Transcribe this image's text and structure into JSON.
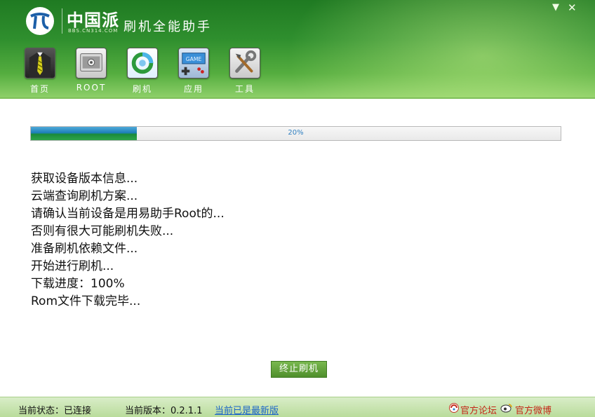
{
  "app": {
    "logo_text": "中国派",
    "logo_sub": "BBS.CN314.COM",
    "title": "刷机全能助手"
  },
  "window": {
    "minimize": "▼",
    "close": "✕"
  },
  "nav": [
    {
      "label": "首页",
      "icon": "tie-icon"
    },
    {
      "label": "ROOT",
      "icon": "root-icon"
    },
    {
      "label": "刷机",
      "icon": "flash-refresh-icon"
    },
    {
      "label": "应用",
      "icon": "game-icon"
    },
    {
      "label": "工具",
      "icon": "tools-icon"
    }
  ],
  "progress": {
    "value": 0.2,
    "text": "20%"
  },
  "log": [
    "获取设备版本信息...",
    "云端查询刷机方案...",
    "请确认当前设备是用易助手Root的...",
    "否则有很大可能刷机失败...",
    "准备刷机依赖文件...",
    "开始进行刷机...",
    "下载进度：100%",
    "Rom文件下载完毕..."
  ],
  "actions": {
    "stop_label": "终止刷机"
  },
  "status": {
    "state": "当前状态：已连接",
    "version": "当前版本：0.2.1.1",
    "latest": "当前已是最新版",
    "forum": "官方论坛",
    "weibo": "官方微博"
  },
  "colors": {
    "header_green": "#2f8f2e",
    "progress_blue": "#1d7fb8",
    "link_blue": "#1a64c8",
    "forum_red": "#c42a1a"
  }
}
